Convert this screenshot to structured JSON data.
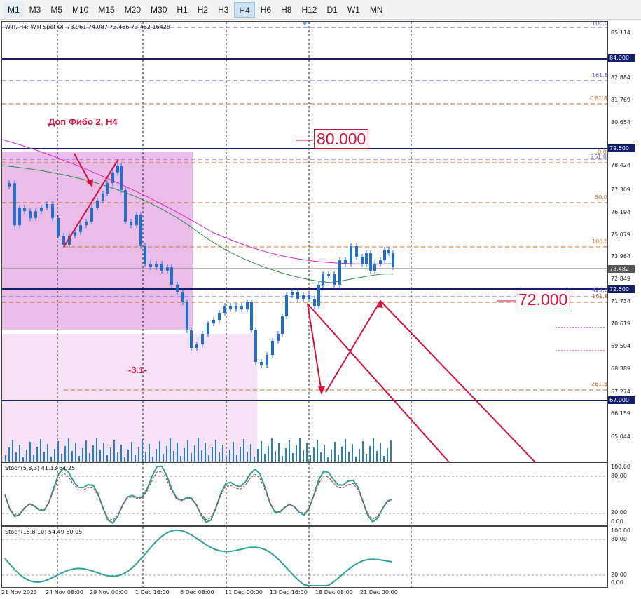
{
  "timeframes": [
    "M1",
    "M3",
    "M5",
    "M10",
    "M15",
    "M20",
    "M30",
    "H1",
    "H2",
    "H3",
    "H4",
    "H6",
    "H8",
    "H12",
    "D1",
    "W1",
    "MN"
  ],
  "active_timeframe": "H4",
  "chart": {
    "symbol_info": "WTI, H4:  WTI Spot Oil  73.961 74.087 73.466 73.482  16428",
    "annotation_fibo": "Доп Фибо 2, H4",
    "annotation_wave": "-3.1-",
    "price_box_80": "80.000",
    "price_box_72": "72.000",
    "fib_labels": {
      "top": "100.0",
      "f1618a": "161.8",
      "f1618b": "-161.8",
      "f00": "0.0",
      "f2618": "261.8",
      "f50": "50.0",
      "f100": "100.0",
      "f4236": "423.6",
      "f1618c": "161.8",
      "f2618b": "261.8"
    },
    "price_scale": [
      "85.114",
      "82.884",
      "81.769",
      "80.654",
      "78.424",
      "77.309",
      "76.194",
      "75.079",
      "73.964",
      "72.849",
      "71.734",
      "70.619",
      "69.504",
      "68.389",
      "67.274",
      "66.159",
      "65.044"
    ],
    "level_tags": {
      "l84": "84.000",
      "l795": "79.500",
      "cur": "73.482",
      "l725": "72.500",
      "l67": "67.000"
    },
    "time_labels": [
      "21 Nov 2023",
      "24 Nov 08:00",
      "29 Nov 00:00",
      "1 Dec 16:00",
      "6 Dec 08:00",
      "11 Dec 00:00",
      "13 Dec 16:00",
      "18 Dec 08:00",
      "21 Dec 00:00"
    ],
    "colors": {
      "level_line": "#131f6d",
      "fib_orange": "#d2691e",
      "fib_purple": "#6a5acd",
      "annotation": "#d4113b",
      "ma_magenta": "#e020d0",
      "ma_green": "#2e8b57",
      "candle_up": "#1e6fd0",
      "candle_down": "#1e6fd0"
    }
  },
  "stoch1": {
    "label": "Stoch(5,3,3) 41.13 64.25",
    "scale": [
      "100.00",
      "80.00",
      "20.00",
      "0.00"
    ]
  },
  "stoch2": {
    "label": "Stoch(15,8,10) 54.49 60.05",
    "scale": [
      "100.00",
      "80.00",
      "20.00",
      "0.00"
    ]
  }
}
